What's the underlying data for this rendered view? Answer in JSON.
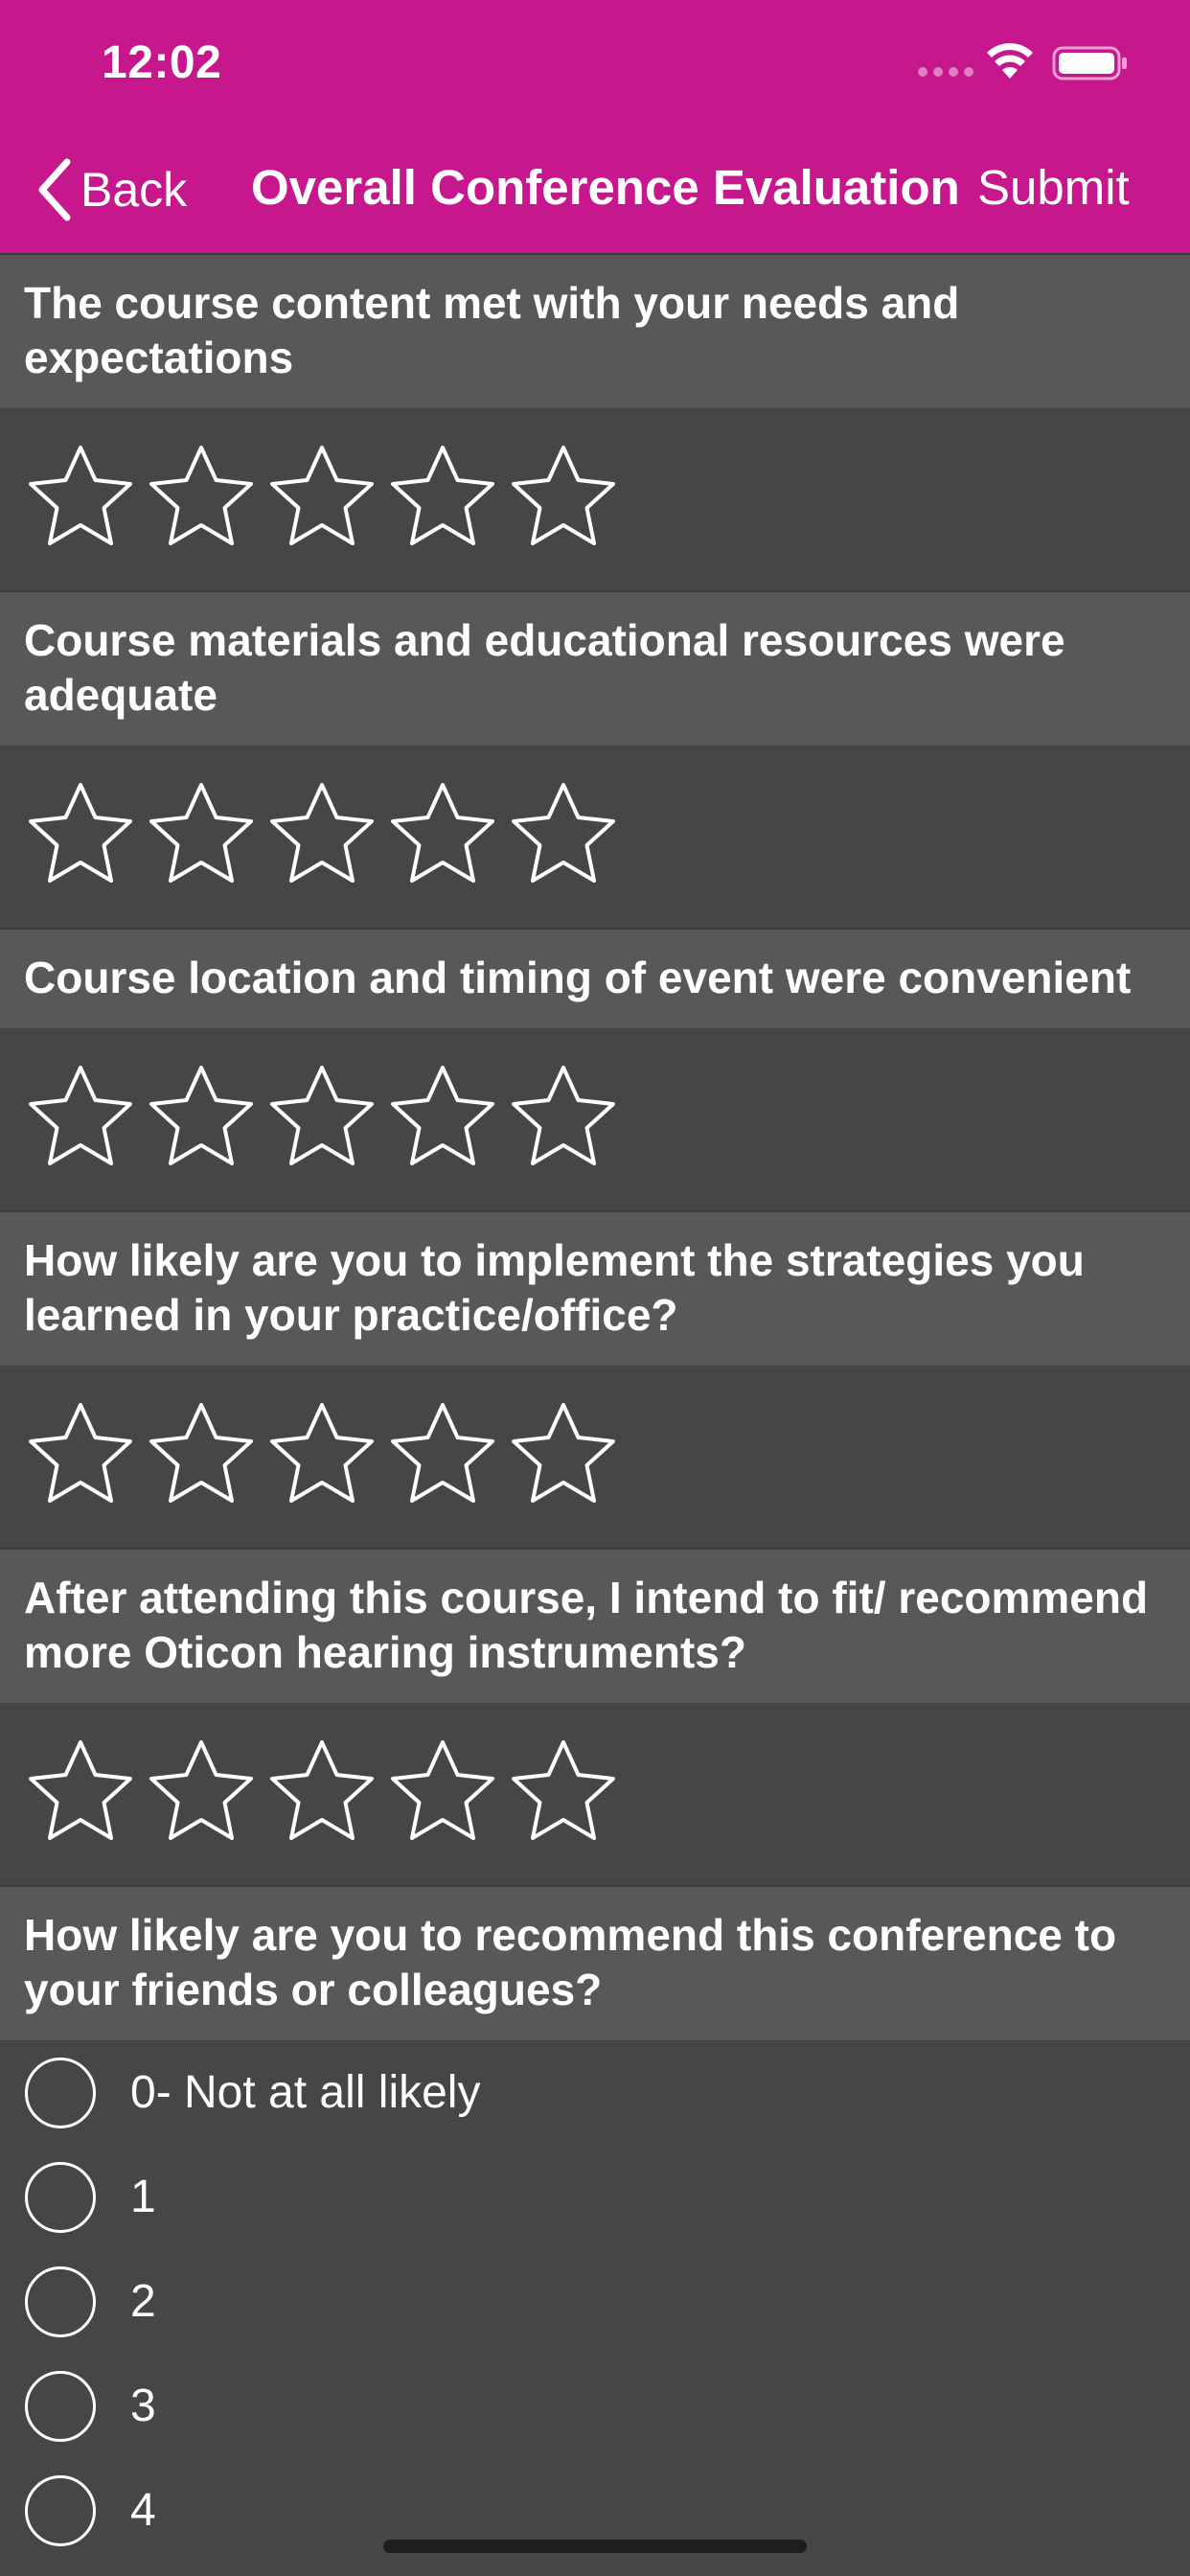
{
  "status_bar": {
    "time": "12:02"
  },
  "nav": {
    "back_label": "Back",
    "title": "Overall Conference Evaluation",
    "submit_label": "Submit"
  },
  "colors": {
    "header": "#C7178C",
    "background": "#464648",
    "question_bg": "#58585B"
  },
  "star_questions": [
    {
      "text": "The course content met with your needs and expectations",
      "rating": 0,
      "max": 5
    },
    {
      "text": "Course materials and educational resources were adequate",
      "rating": 0,
      "max": 5
    },
    {
      "text": "Course location and timing of event were convenient",
      "rating": 0,
      "max": 5
    },
    {
      "text": "How likely are you to implement the strategies you learned in your practice/office?",
      "rating": 0,
      "max": 5
    },
    {
      "text": "After attending this course, I intend to fit/ recommend more Oticon hearing instruments?",
      "rating": 0,
      "max": 5
    }
  ],
  "radio_question": {
    "text": "How likely are you to recommend this conference to your friends or colleagues?",
    "options": [
      "0- Not at all likely",
      "1",
      "2",
      "3",
      "4"
    ]
  }
}
